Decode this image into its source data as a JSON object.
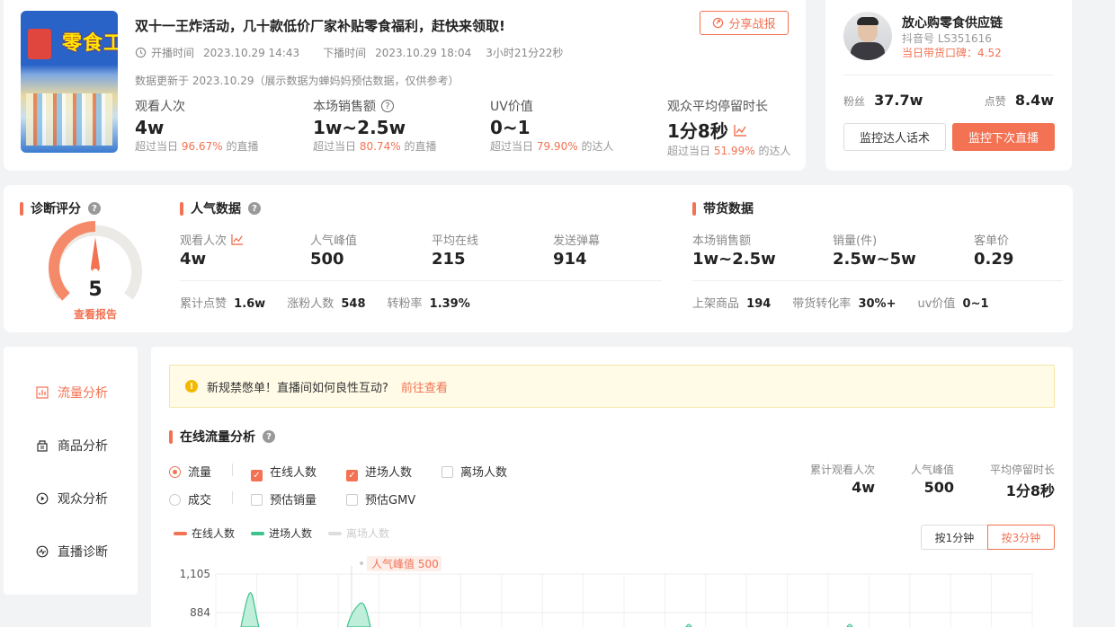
{
  "live": {
    "cover_text": "零食工",
    "title": "双十一王炸活动，几十款低价厂家补贴零食福利，赶快来领取!",
    "share_label": "分享战报",
    "start_label": "开播时间",
    "start_time": "2023.10.29 14:43",
    "end_label": "下播时间",
    "end_time": "2023.10.29 18:04",
    "duration": "3小时21分22秒",
    "update_note": "数据更新于 2023.10.29（展示数据为蝉妈妈预估数据，仅供参考）",
    "stats": [
      {
        "label": "观看人次",
        "value": "4w",
        "prefix": "超过当日",
        "pct": "96.67%",
        "suffix": "的直播"
      },
      {
        "label": "本场销售额",
        "value": "1w~2.5w",
        "prefix": "超过当日",
        "pct": "80.74%",
        "suffix": "的直播"
      },
      {
        "label": "UV价值",
        "value": "0~1",
        "prefix": "超过当日",
        "pct": "79.90%",
        "suffix": "的达人"
      },
      {
        "label": "观众平均停留时长",
        "value": "1分8秒",
        "prefix": "超过当日",
        "pct": "51.99%",
        "suffix": "的达人"
      }
    ]
  },
  "anchor": {
    "name": "放心购零食供应链",
    "douyin_id": "抖音号 LS351616",
    "reputation": "当日带货口碑：4.52",
    "fans_label": "粉丝",
    "fans_value": "37.7w",
    "likes_label": "点赞",
    "likes_value": "8.4w",
    "btn_script": "监控达人话术",
    "btn_monitor": "监控下次直播"
  },
  "diagnosis": {
    "title": "诊断评分",
    "score": "5",
    "score_fraction": 0.5,
    "link": "查看报告"
  },
  "popularity": {
    "title": "人气数据",
    "metrics": [
      {
        "label": "观看人次",
        "value": "4w"
      },
      {
        "label": "人气峰值",
        "value": "500"
      },
      {
        "label": "平均在线",
        "value": "215"
      },
      {
        "label": "发送弹幕",
        "value": "914"
      }
    ],
    "sub": [
      {
        "label": "累计点赞",
        "value": "1.6w"
      },
      {
        "label": "涨粉人数",
        "value": "548"
      },
      {
        "label": "转粉率",
        "value": "1.39%"
      }
    ]
  },
  "sales": {
    "title": "带货数据",
    "metrics": [
      {
        "label": "本场销售额",
        "value": "1w~2.5w"
      },
      {
        "label": "销量(件)",
        "value": "2.5w~5w"
      },
      {
        "label": "客单价",
        "value": "0.29"
      }
    ],
    "sub": [
      {
        "label": "上架商品",
        "value": "194"
      },
      {
        "label": "带货转化率",
        "value": "30%+"
      },
      {
        "label": "uv价值",
        "value": "0~1"
      }
    ]
  },
  "sidebar": {
    "items": [
      {
        "label": "流量分析",
        "icon": "bar-chart-icon",
        "active": true
      },
      {
        "label": "商品分析",
        "icon": "goods-icon",
        "active": false
      },
      {
        "label": "观众分析",
        "icon": "play-circle-icon",
        "active": false
      },
      {
        "label": "直播诊断",
        "icon": "pulse-icon",
        "active": false
      }
    ]
  },
  "notice": {
    "text": "新规禁憋单！直播间如何良性互动?",
    "link": "前往查看"
  },
  "traffic": {
    "title": "在线流量分析",
    "options": {
      "flow": "流量",
      "deal": "成交",
      "online": "在线人数",
      "enter": "进场人数",
      "leave": "离场人数",
      "est_sales": "预估销量",
      "est_gmv": "预估GMV"
    },
    "summary": [
      {
        "label": "累计观看人次",
        "value": "4w"
      },
      {
        "label": "人气峰值",
        "value": "500"
      },
      {
        "label": "平均停留时长",
        "value": "1分8秒"
      }
    ],
    "btn_1min": "按1分钟",
    "btn_3min": "按3分钟",
    "peak_label": "人气峰值 500"
  },
  "chart_data": {
    "type": "area",
    "series": [
      {
        "name": "在线人数",
        "color": "#f27253"
      },
      {
        "name": "进场人数",
        "color": "#3cc48c"
      },
      {
        "name": "离场人数",
        "color": "#cccccc"
      }
    ],
    "yticks": [
      "1,105",
      "884"
    ],
    "ylim_visible": [
      884,
      1105
    ]
  },
  "colors": {
    "accent": "#f27253",
    "green": "#3cc48c",
    "notice_bg": "#fffbe6"
  }
}
